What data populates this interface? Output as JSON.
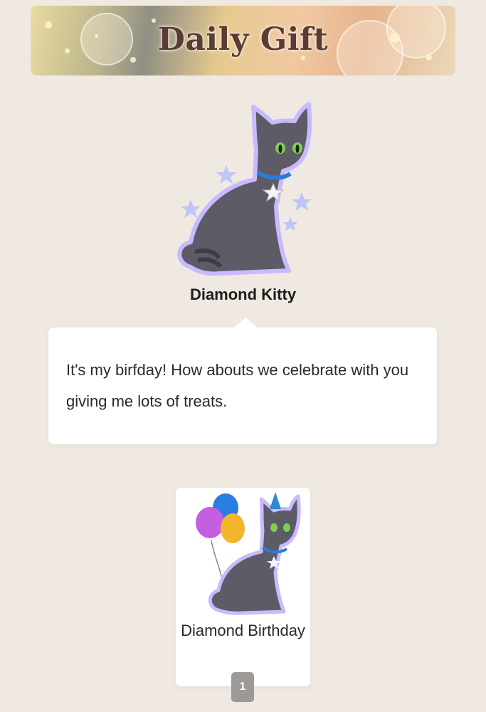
{
  "header": {
    "title": "Daily Gift"
  },
  "pet": {
    "name": "Diamond Kitty",
    "image": "diamond-kitty-icon"
  },
  "message": {
    "text": "It's my birfday! How abouts we celebrate with you giving me lots of treats."
  },
  "gift": {
    "name": "Diamond Birthday",
    "image": "diamond-birthday-kitty-icon",
    "quantity": "1"
  },
  "colors": {
    "background": "#efe9e1",
    "card": "#ffffff",
    "badge": "#9c9997",
    "title": "#5a3c33"
  }
}
